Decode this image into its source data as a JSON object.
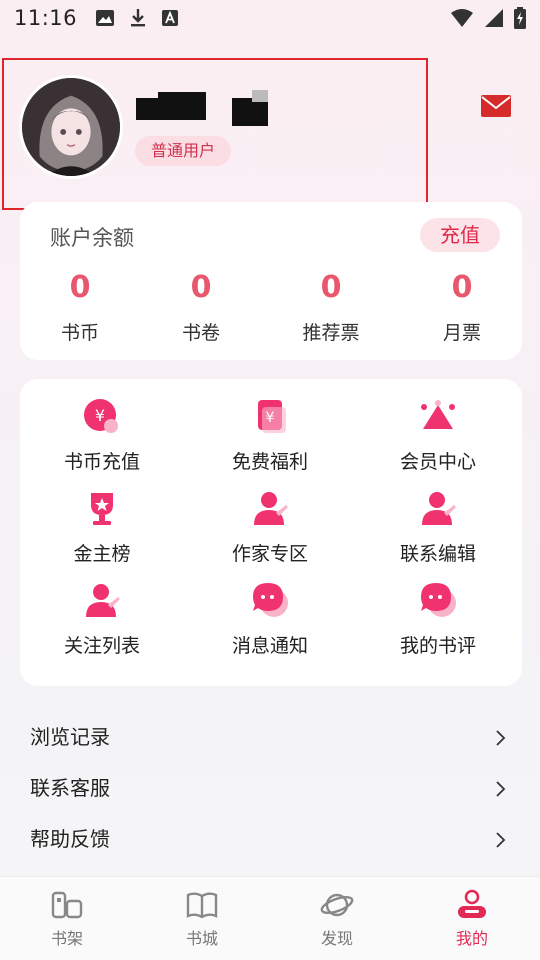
{
  "status_bar": {
    "time": "11:16"
  },
  "profile": {
    "badge": "普通用户"
  },
  "balance": {
    "title": "账户余额",
    "recharge_label": "充值",
    "stats": [
      {
        "value": "0",
        "label": "书币"
      },
      {
        "value": "0",
        "label": "书卷"
      },
      {
        "value": "0",
        "label": "推荐票"
      },
      {
        "value": "0",
        "label": "月票"
      }
    ]
  },
  "features": [
    {
      "label": "书币充值",
      "icon": "coin-recharge-icon"
    },
    {
      "label": "免费福利",
      "icon": "red-envelope-icon"
    },
    {
      "label": "会员中心",
      "icon": "crown-icon"
    },
    {
      "label": "金主榜",
      "icon": "trophy-icon"
    },
    {
      "label": "作家专区",
      "icon": "writer-icon"
    },
    {
      "label": "联系编辑",
      "icon": "editor-icon"
    },
    {
      "label": "关注列表",
      "icon": "follow-list-icon"
    },
    {
      "label": "消息通知",
      "icon": "message-icon"
    },
    {
      "label": "我的书评",
      "icon": "review-icon"
    }
  ],
  "menu": [
    {
      "label": "浏览记录"
    },
    {
      "label": "联系客服"
    },
    {
      "label": "帮助反馈"
    }
  ],
  "tabs": [
    {
      "label": "书架",
      "icon": "bookshelf-icon"
    },
    {
      "label": "书城",
      "icon": "book-icon"
    },
    {
      "label": "发现",
      "icon": "planet-icon"
    },
    {
      "label": "我的",
      "icon": "profile-icon"
    }
  ],
  "colors": {
    "accent": "#e8576e",
    "badge_bg": "#fbdde4",
    "active_tab": "#e22a57"
  }
}
